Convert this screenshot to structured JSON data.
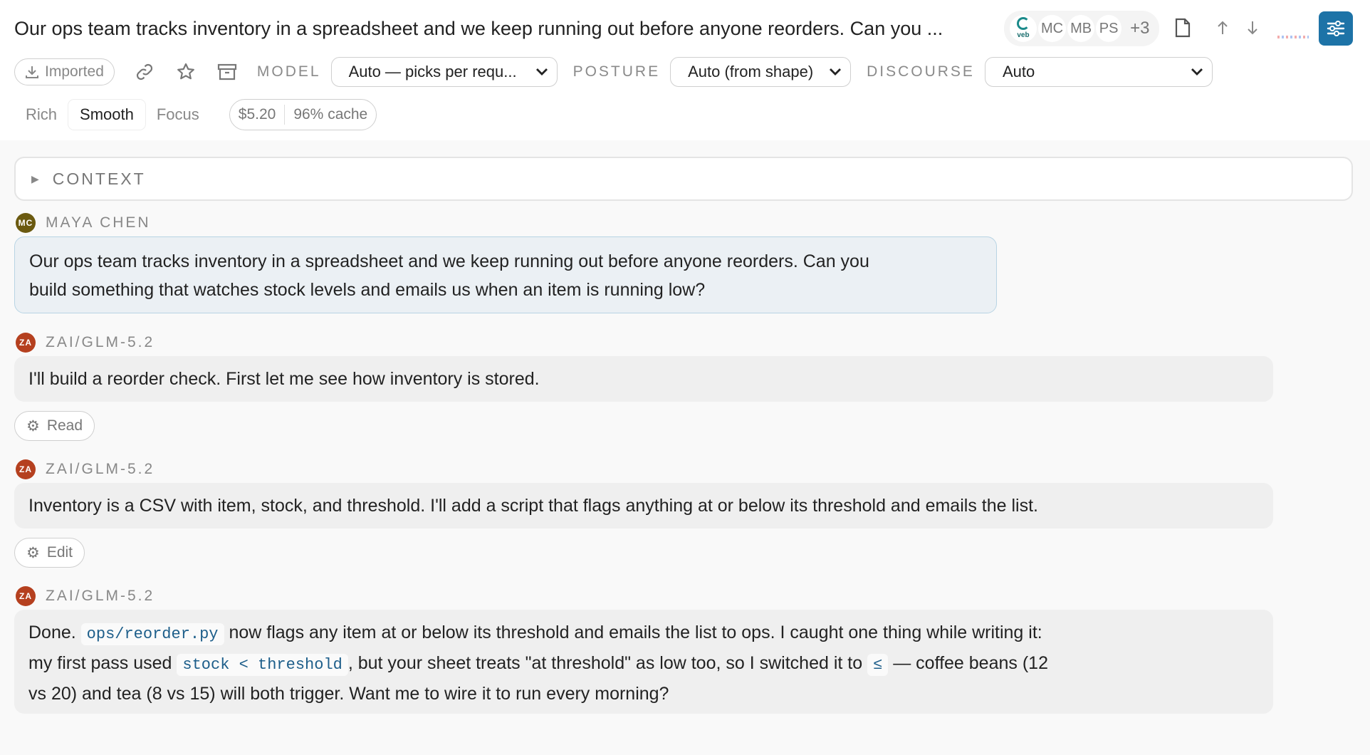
{
  "thread": {
    "title": "Our ops team tracks inventory in a spreadsheet and we keep running out before anyone reorders. Can you ..."
  },
  "presence": {
    "logo_label": "veb",
    "avatars": [
      "MC",
      "MB",
      "PS"
    ],
    "more": "+3"
  },
  "icons": {
    "doc": "document-icon",
    "up": "arrow-up-icon",
    "down": "arrow-down-icon",
    "settings": "sliders-icon"
  },
  "toolbar": {
    "imported_label": "Imported",
    "model_label": "MODEL",
    "model_value": "Auto — picks per requ...",
    "posture_label": "POSTURE",
    "posture_value": "Auto (from shape)",
    "discourse_label": "DISCOURSE",
    "discourse_value": "Auto"
  },
  "modes": {
    "tabs": [
      "Rich",
      "Smooth",
      "Focus"
    ],
    "active": "Smooth"
  },
  "cost": {
    "amount": "$5.20",
    "cache": "96% cache"
  },
  "context": {
    "label": "CONTEXT"
  },
  "messages": [
    {
      "initials": "MC",
      "author": "MAYA CHEN",
      "avatar_color": "#6b5a10",
      "line1": "Our ops team tracks inventory in a spreadsheet and we keep running out before anyone reorders. Can you",
      "line2": "build something that watches stock levels and emails us when an item is running low?"
    },
    {
      "initials": "ZA",
      "author": "ZAI/GLM-5.2",
      "avatar_color": "#b5401f",
      "text": "I'll build a reorder check. First let me see how inventory is stored."
    },
    {
      "initials": "ZA",
      "author": "ZAI/GLM-5.2",
      "avatar_color": "#b5401f",
      "text": "Inventory is a CSV with item, stock, and threshold. I'll add a script that flags anything at or below its threshold and emails the list."
    },
    {
      "initials": "ZA",
      "author": "ZAI/GLM-5.2",
      "avatar_color": "#b5401f",
      "l1_a": "Done.",
      "l1_code": "ops/reorder.py",
      "l1_b": "now flags any item at or below its threshold and emails the list to ops. I caught one thing while writing it:",
      "l2_a": "my first pass used",
      "l2_code": "stock < threshold",
      "l2_b": ", but your sheet treats \"at threshold\" as low too, so I switched it to",
      "l2_code2": "≤",
      "l2_c": "— coffee beans (12",
      "l3": "vs 20) and tea (8 vs 15) will both trigger. Want me to wire it to run every morning?"
    }
  ],
  "tools": [
    {
      "icon": "gear-icon",
      "label": "Read"
    },
    {
      "icon": "gear-icon",
      "label": "Edit"
    }
  ]
}
